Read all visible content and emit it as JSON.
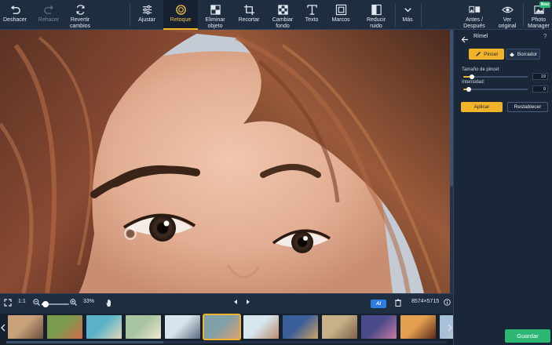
{
  "toolbar": {
    "undo": "Deshacer",
    "redo": "Rehacer",
    "revert": "Revertir cambios",
    "revert_line1": "Revertir",
    "revert_line2": "cambios",
    "adjust": "Ajustar",
    "retouch": "Retoque",
    "erase_line1": "Eliminar",
    "erase_line2": "objeto",
    "crop": "Recortar",
    "bg_line1": "Cambiar",
    "bg_line2": "fondo",
    "text": "Texto",
    "frames": "Marcos",
    "noise_line1": "Reducir",
    "noise_line2": "ruido",
    "more": "Más",
    "before_after_line1": "Antes /",
    "before_after_line2": "Después",
    "original_line1": "Ver",
    "original_line2": "original",
    "pm_line1": "Photo",
    "pm_line2": "Manager",
    "new_badge": "New"
  },
  "canvas": {
    "zoom_fit": "1:1",
    "zoom_percent": "33%",
    "image_size": "8574×5715",
    "zoom_slider_value": 0.15,
    "ai_label": "AI"
  },
  "filmstrip": {
    "thumbs": [
      {
        "name": "thumb-1",
        "colors": [
          "#c9a27a",
          "#6b4e3a"
        ]
      },
      {
        "name": "thumb-2",
        "colors": [
          "#7a9a4c",
          "#d26a4a"
        ]
      },
      {
        "name": "thumb-3",
        "colors": [
          "#5ab3c8",
          "#e8d8b8"
        ]
      },
      {
        "name": "thumb-4",
        "colors": [
          "#a8c4a0",
          "#efe9d0"
        ]
      },
      {
        "name": "thumb-5",
        "colors": [
          "#d8e4ec",
          "#5c6c80"
        ]
      },
      {
        "name": "thumb-6",
        "colors": [
          "#7fa0a8",
          "#d8a274"
        ]
      },
      {
        "name": "thumb-7",
        "colors": [
          "#d7e7ee",
          "#b88c6c"
        ]
      },
      {
        "name": "thumb-8",
        "colors": [
          "#3a5e9a",
          "#d0a460"
        ]
      },
      {
        "name": "thumb-9",
        "colors": [
          "#c8b088",
          "#7a6048"
        ]
      },
      {
        "name": "thumb-10",
        "colors": [
          "#4a4a8a",
          "#c87aa0"
        ]
      },
      {
        "name": "thumb-11",
        "colors": [
          "#e4a050",
          "#5a2a1a"
        ]
      },
      {
        "name": "thumb-12",
        "colors": [
          "#a8c0d8",
          "#e8e0d0"
        ]
      },
      {
        "name": "thumb-13",
        "colors": [
          "#c8ccd4",
          "#9a7060"
        ]
      }
    ]
  },
  "panel": {
    "title": "Rímel",
    "help": "?",
    "brush": "Pincel",
    "eraser": "Borrador",
    "brush_size_label": "Tamaño de pincel:",
    "brush_size_value": "19",
    "brush_size_fraction": 0.13,
    "intensity_label": "Intensidad:",
    "intensity_value": "9",
    "intensity_fraction": 0.09,
    "apply": "Aplicar",
    "reset": "Restablecer",
    "save": "Guardar"
  }
}
